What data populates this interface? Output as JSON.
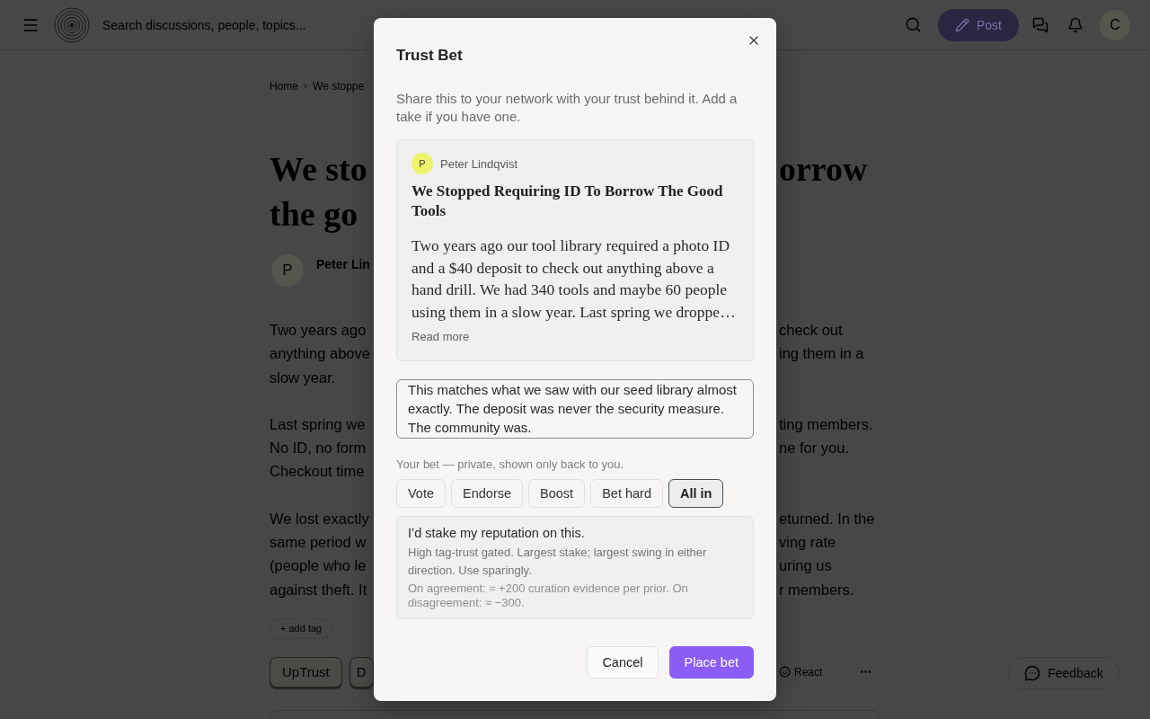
{
  "topbar": {
    "search": {
      "placeholder": "Search discussions, people, topics..."
    },
    "post_button": "Post",
    "avatar": "C"
  },
  "breadcrumb": [
    {
      "label": "Home"
    },
    {
      "label": "We stoppe"
    }
  ],
  "article": {
    "title_lines": [
      {
        "left": "We sto",
        "right": "orrow"
      },
      {
        "left": "the go"
      }
    ],
    "author": {
      "avatar": "P",
      "name": "Peter Lin"
    },
    "paragraphs": [
      [
        {
          "left": "Two years ago",
          "right": "check out"
        },
        {
          "left": "anything above",
          "right": "ing them in a"
        },
        {
          "left": "slow year."
        }
      ],
      [
        {
          "left": "Last spring we",
          "right": "ting members."
        },
        {
          "left": "No ID, no form",
          "right": "ne for you."
        },
        {
          "left": "Checkout time"
        }
      ],
      [
        {
          "left": "We lost exactly",
          "right": "eturned. In the"
        },
        {
          "left": "same period w",
          "right": "ving rate"
        },
        {
          "left": "(people who le",
          "right": "uring us"
        },
        {
          "left": "against theft. It",
          "right": "r members."
        }
      ]
    ],
    "add_tag": "+ add tag",
    "actions": [
      {
        "label": "UpTrust"
      },
      {
        "label": "D"
      }
    ],
    "react": "React"
  },
  "feedback": "Feedback",
  "modal": {
    "title": "Trust Bet",
    "description": "Share this to your network with your trust behind it. Add a take if you have one.",
    "preview": {
      "avatar": "P",
      "author": "Peter Lindqvist",
      "title": "We Stopped Requiring ID To Borrow The Good Tools",
      "excerpt": "Two years ago our tool library required a photo ID and a $40 deposit to check out anything above a hand drill. We had 340 tools and maybe 60 people using them in a slow year. Last spring we droppe…",
      "read_more": "Read more"
    },
    "take": {
      "value": "This matches what we saw with our seed library almost exactly. The deposit was never the security measure. The community was."
    },
    "bet_label": "Your bet — private, shown only back to you.",
    "bet_options": [
      {
        "label": "Vote",
        "selected": false
      },
      {
        "label": "Endorse",
        "selected": false
      },
      {
        "label": "Boost",
        "selected": false
      },
      {
        "label": "Bet hard",
        "selected": false
      },
      {
        "label": "All in",
        "selected": true
      }
    ],
    "bet_detail": {
      "headline": "I’d stake my reputation on this.",
      "description": "High tag-trust gated. Largest stake; largest swing in either direction. Use sparingly.",
      "effects": "On agreement: ≈ +200 curation evidence per prior. On disagreement: ≈ −300."
    },
    "buttons": [
      {
        "label": "Cancel",
        "kind": "secondary"
      },
      {
        "label": "Place bet",
        "kind": "primary"
      }
    ]
  }
}
